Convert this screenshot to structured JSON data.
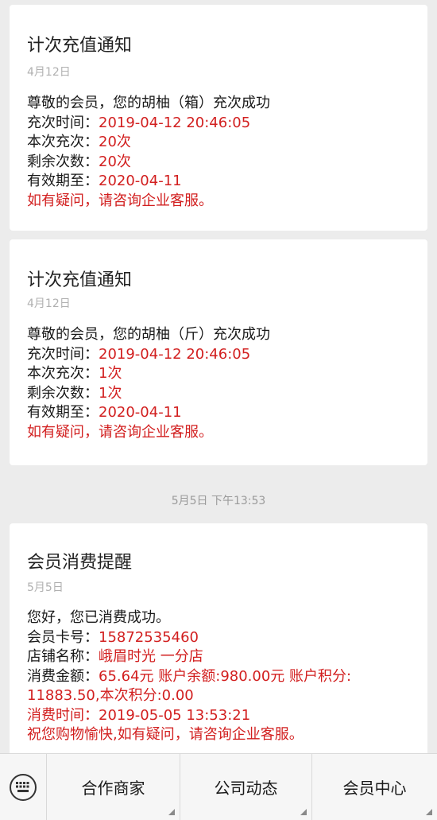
{
  "cards": [
    {
      "title": "计次充值通知",
      "date": "4月12日",
      "greeting": "尊敬的会员，您的胡柚（箱）充次成功",
      "time_label": "充次时间：",
      "time_value": "2019-04-12 20:46:05",
      "count_label": "本次充次：",
      "count_value": "20次",
      "remaining_label": "剩余次数：",
      "remaining_value": "20次",
      "valid_label": "有效期至：",
      "valid_value": "2020-04-11",
      "notice": "如有疑问，请咨询企业客服。"
    },
    {
      "title": "计次充值通知",
      "date": "4月12日",
      "greeting": "尊敬的会员，您的胡柚（斤）充次成功",
      "time_label": "充次时间：",
      "time_value": "2019-04-12 20:46:05",
      "count_label": "本次充次：",
      "count_value": "1次",
      "remaining_label": "剩余次数：",
      "remaining_value": "1次",
      "valid_label": "有效期至：",
      "valid_value": "2020-04-11",
      "notice": "如有疑问，请咨询企业客服。"
    }
  ],
  "timestamp": "5月5日 下午13:53",
  "consume_card": {
    "title": "会员消费提醒",
    "date": "5月5日",
    "greeting": "您好，您已消费成功。",
    "card_no_label": "会员卡号：",
    "card_no_value": "15872535460",
    "store_label": "店铺名称：",
    "store_value": "峨眉时光 一分店",
    "amount_label": "消费金额：",
    "amount_value": "65.64元 账户余额:980.00元 账户积分:",
    "amount_value_cont": "11883.50,本次积分:0.00",
    "time_line": "消费时间：2019-05-05 13:53:21",
    "notice": "祝您购物愉快,如有疑问，请咨询企业客服。"
  },
  "bottom_menu": {
    "keyboard_icon": "keyboard-icon",
    "items": [
      {
        "label": "合作商家"
      },
      {
        "label": "公司动态"
      },
      {
        "label": "会员中心"
      }
    ]
  }
}
